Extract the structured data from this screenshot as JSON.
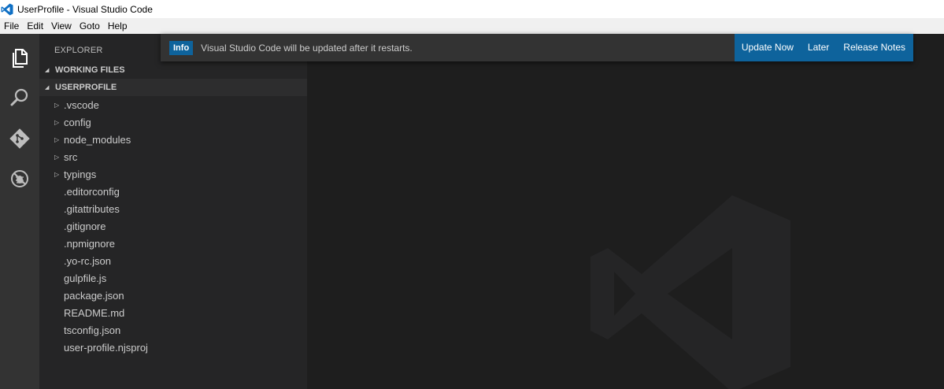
{
  "window": {
    "title": "UserProfile - Visual Studio Code",
    "logo_icon": "vscode-logo-icon"
  },
  "menu": [
    "File",
    "Edit",
    "View",
    "Goto",
    "Help"
  ],
  "activity_bar": {
    "icons": [
      "explorer-icon",
      "search-icon",
      "git-icon",
      "debug-icon"
    ],
    "background": "#333333"
  },
  "sidebar": {
    "title": "EXPLORER",
    "sections": [
      {
        "label": "WORKING FILES"
      },
      {
        "label": "USERPROFILE"
      }
    ],
    "tree": [
      {
        "label": ".vscode",
        "folder": true
      },
      {
        "label": "config",
        "folder": true
      },
      {
        "label": "node_modules",
        "folder": true
      },
      {
        "label": "src",
        "folder": true
      },
      {
        "label": "typings",
        "folder": true
      },
      {
        "label": ".editorconfig",
        "folder": false
      },
      {
        "label": ".gitattributes",
        "folder": false
      },
      {
        "label": ".gitignore",
        "folder": false
      },
      {
        "label": ".npmignore",
        "folder": false
      },
      {
        "label": ".yo-rc.json",
        "folder": false
      },
      {
        "label": "gulpfile.js",
        "folder": false
      },
      {
        "label": "package.json",
        "folder": false
      },
      {
        "label": "README.md",
        "folder": false
      },
      {
        "label": "tsconfig.json",
        "folder": false
      },
      {
        "label": "user-profile.njsproj",
        "folder": false
      }
    ]
  },
  "notification": {
    "badge": "Info",
    "message": "Visual Studio Code will be updated after it restarts.",
    "actions": [
      "Update Now",
      "Later",
      "Release Notes"
    ],
    "accent": "#0e639c"
  },
  "colors": {
    "editor_bg": "#1e1e1e",
    "sidebar_bg": "#252526"
  }
}
